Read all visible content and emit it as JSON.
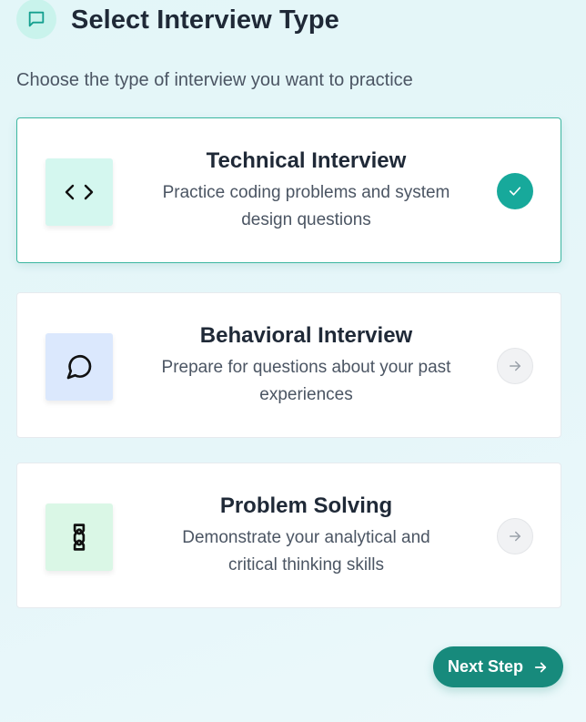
{
  "header": {
    "title": "Select Interview Type",
    "subtitle": "Choose the type of interview you want to practice",
    "icon": "message-square-icon"
  },
  "options": [
    {
      "title": "Technical Interview",
      "desc_line1": "Practice coding problems and system",
      "desc_line2": "design questions",
      "icon": "code-icon",
      "tile_color": "#d4f7ef",
      "selected": true,
      "status_icon": "check-icon"
    },
    {
      "title": "Behavioral Interview",
      "desc_line1": "Prepare for questions about your past",
      "desc_line2": "experiences",
      "icon": "message-circle-icon",
      "tile_color": "#dbe8fd",
      "selected": false,
      "status_icon": "arrow-right-icon"
    },
    {
      "title": "Problem Solving",
      "desc_line1": "Demonstrate your analytical and",
      "desc_line2": "critical thinking skills",
      "icon": "puzzle-icon",
      "tile_color": "#daf7e6",
      "selected": false,
      "status_icon": "arrow-right-icon"
    }
  ],
  "footer": {
    "next_label": "Next Step",
    "next_icon": "arrow-right-icon"
  },
  "colors": {
    "accent": "#178a7c",
    "selected_border": "#3bb6a0",
    "check_bg": "#17a99b"
  }
}
